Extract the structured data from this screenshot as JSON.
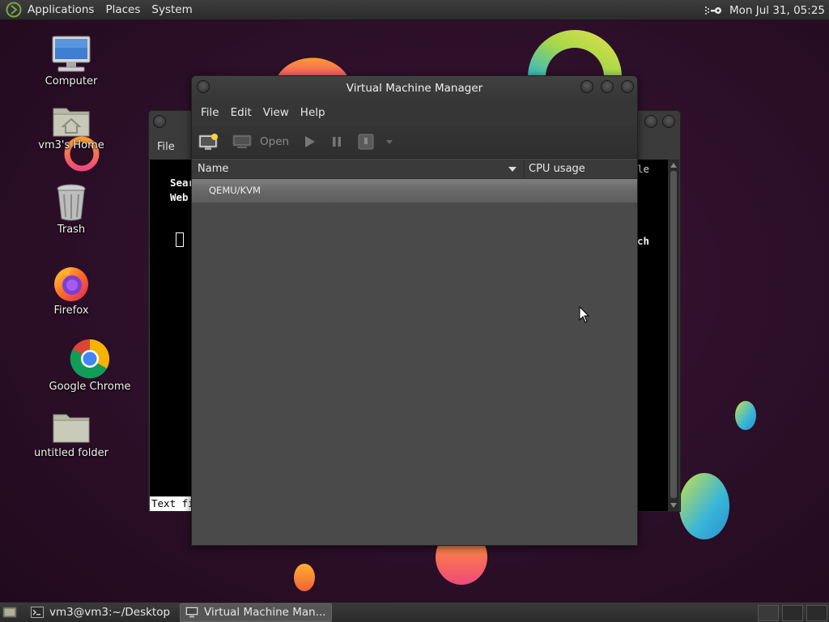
{
  "top_panel": {
    "menus": [
      "Applications",
      "Places",
      "System"
    ],
    "clock": "Mon Jul 31, 05:25",
    "logo_icon": "mate-logo-icon",
    "network_icon": "network-key-icon"
  },
  "desktop_icons": [
    {
      "label": "Computer",
      "icon": "computer-icon"
    },
    {
      "label": "vm3's Home",
      "icon": "home-folder-icon"
    },
    {
      "label": "Trash",
      "icon": "trash-icon"
    },
    {
      "label": "Firefox",
      "icon": "firefox-icon"
    },
    {
      "label": "Google Chrome",
      "icon": "chrome-icon"
    },
    {
      "label": "untitled folder",
      "icon": "folder-icon"
    }
  ],
  "background_window": {
    "menu_file": "File",
    "line1": "Sear",
    "line2": "Web",
    "right_top": "ogle",
    "right_mid": "arch",
    "status": "Text fi"
  },
  "vmm": {
    "title": "Virtual Machine Manager",
    "menu": [
      "File",
      "Edit",
      "View",
      "Help"
    ],
    "toolbar": {
      "open_label": "Open"
    },
    "columns": {
      "name": "Name",
      "cpu": "CPU usage"
    },
    "connections": [
      "QEMU/KVM"
    ]
  },
  "taskbar": {
    "tasks": [
      {
        "label": "vm3@vm3:~/Desktop",
        "active": false
      },
      {
        "label": "Virtual Machine Man...",
        "active": true
      }
    ]
  },
  "colors": {
    "wallpaper": "#2a0f26",
    "panel": "#2e2e2e",
    "window_bg": "#4a4a4a",
    "selected_row": "#6e6e6e"
  }
}
